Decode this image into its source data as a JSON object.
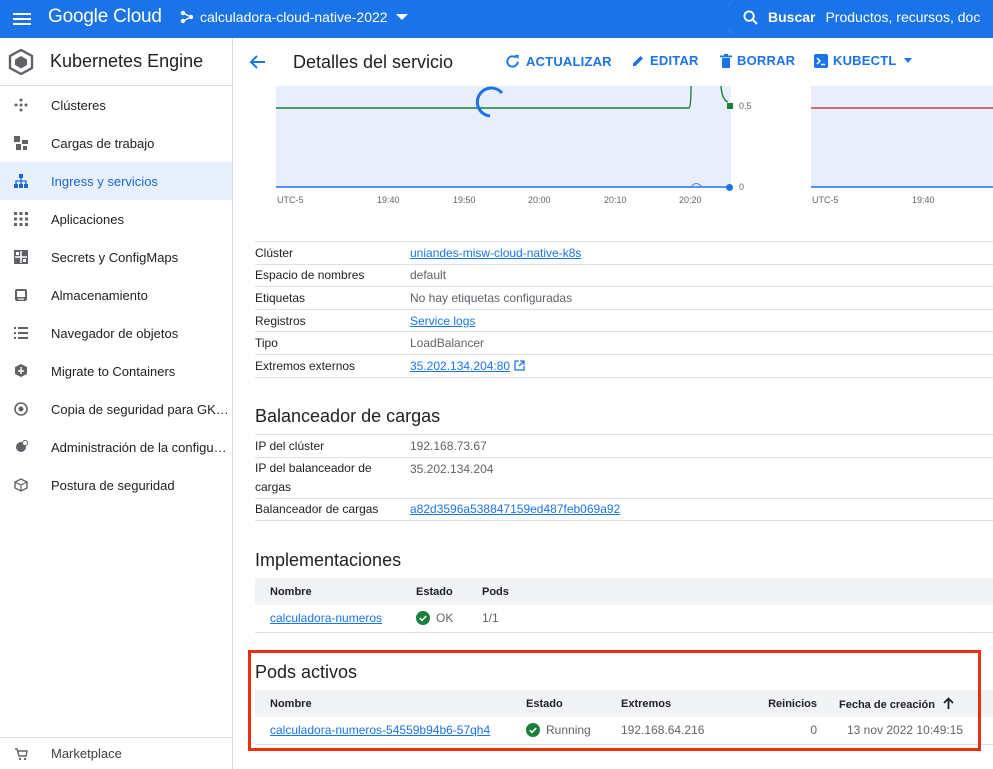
{
  "topbar": {
    "brand": "Google Cloud",
    "project": "calculadora-cloud-native-2022",
    "search_label": "Buscar",
    "search_placeholder": "Productos, recursos, doc"
  },
  "sidebar": {
    "title": "Kubernetes Engine",
    "items": [
      {
        "label": "Clústeres",
        "icon": "clusters-icon",
        "active": false
      },
      {
        "label": "Cargas de trabajo",
        "icon": "workloads-icon",
        "active": false
      },
      {
        "label": "Ingress y servicios",
        "icon": "network-icon",
        "active": true
      },
      {
        "label": "Aplicaciones",
        "icon": "apps-grid-icon",
        "active": false
      },
      {
        "label": "Secrets y ConfigMaps",
        "icon": "grid-icon",
        "active": false
      },
      {
        "label": "Almacenamiento",
        "icon": "storage-icon",
        "active": false
      },
      {
        "label": "Navegador de objetos",
        "icon": "list-icon",
        "active": false
      },
      {
        "label": "Migrate to Containers",
        "icon": "migrate-icon",
        "active": false
      },
      {
        "label": "Copia de seguridad para GK…",
        "icon": "backup-icon",
        "active": false
      },
      {
        "label": "Administración de la configu…",
        "icon": "config-icon",
        "active": false
      },
      {
        "label": "Postura de seguridad",
        "icon": "security-icon",
        "active": false
      }
    ],
    "bottom": {
      "label": "Marketplace",
      "icon": "marketplace-icon"
    }
  },
  "actionbar": {
    "title": "Detalles del servicio",
    "refresh": "ACTUALIZAR",
    "edit": "EDITAR",
    "delete": "BORRAR",
    "kubectl": "KUBECTL"
  },
  "chart": {
    "xticks": [
      "UTC-5",
      "19:40",
      "19:50",
      "20:00",
      "20:10",
      "20:20"
    ],
    "yticks": [
      "0.5",
      "0"
    ],
    "xticks2": [
      "UTC-5",
      "19:40"
    ],
    "colors": {
      "line": "#188038",
      "zero": "#4285f4",
      "red": "#c5221f"
    }
  },
  "service": {
    "rows": [
      {
        "key": "Clúster",
        "value": "uniandes-misw-cloud-native-k8s",
        "link": true
      },
      {
        "key": "Espacio de nombres",
        "value": "default",
        "link": false
      },
      {
        "key": "Etiquetas",
        "value": "No hay etiquetas configuradas",
        "link": false
      },
      {
        "key": "Registros",
        "value": "Service logs",
        "link": true
      },
      {
        "key": "Tipo",
        "value": "LoadBalancer",
        "link": false
      },
      {
        "key": "Extremos externos",
        "value": "35.202.134.204:80",
        "link": true
      }
    ]
  },
  "lb": {
    "title": "Balanceador de cargas",
    "rows": [
      {
        "key": "IP del clúster",
        "value": "192.168.73.67"
      },
      {
        "key": "IP del balanceador de cargas",
        "value": "35.202.134.204"
      },
      {
        "key": "Balanceador de cargas",
        "value": "a82d3596a538847159ed487feb069a92"
      }
    ]
  },
  "deployments": {
    "title": "Implementaciones",
    "headers": [
      "Nombre",
      "Estado",
      "Pods"
    ],
    "rows": [
      {
        "name": "calculadora-numeros",
        "status": "OK",
        "pods": "1/1"
      }
    ]
  },
  "pods": {
    "title": "Pods activos",
    "headers": [
      "Nombre",
      "Estado",
      "Extremos",
      "Reinicios",
      "Fecha de creación"
    ],
    "rows": [
      {
        "name": "calculadora-numeros-54559b94b6-57qh4",
        "status": "Running",
        "endpoint": "192.168.64.216",
        "restarts": "0",
        "created": "13 nov 2022 10:49:15"
      }
    ]
  }
}
